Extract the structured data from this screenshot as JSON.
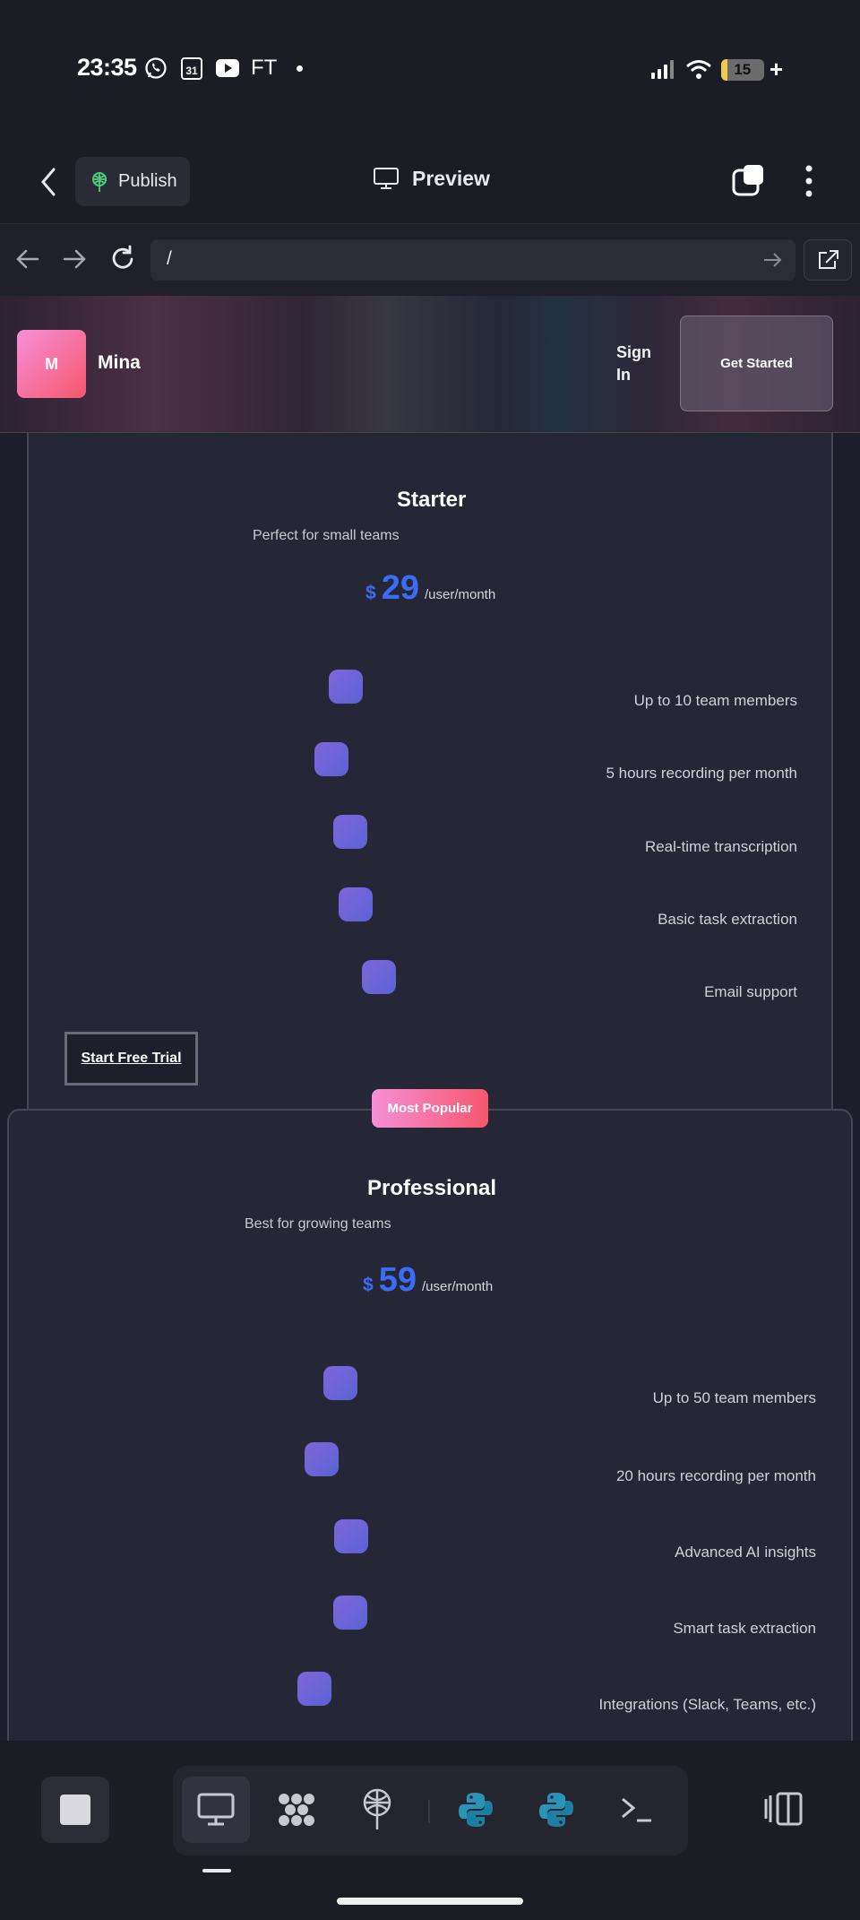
{
  "status_bar": {
    "time": "23:35",
    "notification_icons": [
      "whatsapp-icon",
      "calendar-icon",
      "youtube-icon"
    ],
    "calendar_day": "31",
    "ft_label": "FT",
    "battery_level": "15",
    "battery_fraction": 0.15
  },
  "app_header": {
    "publish_label": "Publish",
    "preview_label": "Preview"
  },
  "browser": {
    "url": "/"
  },
  "site": {
    "logo_letter": "M",
    "brand_name": "Mina",
    "sign_in_label": "Sign In",
    "get_started_label": "Get Started"
  },
  "plans": [
    {
      "name": "Starter",
      "subtitle": "Perfect for small teams",
      "currency": "$",
      "price": "29",
      "period": "/user/month",
      "features": [
        "Up to 10 team members",
        "5 hours recording per month",
        "Real-time transcription",
        "Basic task extraction",
        "Email support"
      ],
      "cta": "Start Free Trial"
    },
    {
      "name": "Professional",
      "badge": "Most Popular",
      "subtitle": "Best for growing teams",
      "currency": "$",
      "price": "59",
      "period": "/user/month",
      "features": [
        "Up to 50 team members",
        "20 hours recording per month",
        "Advanced AI insights",
        "Smart task extraction",
        "Integrations (Slack, Teams, etc.)"
      ]
    }
  ],
  "dock": {
    "items": [
      "stop-icon",
      "desktop-icon",
      "network-icon",
      "antenna-icon",
      "python-icon",
      "python-icon",
      "terminal-icon",
      "sidebar-toggle-icon"
    ]
  }
}
